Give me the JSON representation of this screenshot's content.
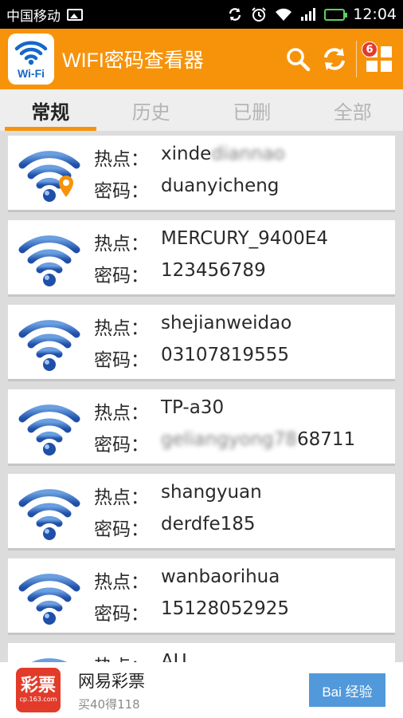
{
  "status_bar": {
    "carrier": "中国移动",
    "time": "12:04",
    "icons": [
      "image-icon",
      "sync-icon",
      "alarm-icon",
      "wifi-signal-icon",
      "cell-signal-icon",
      "battery-icon"
    ]
  },
  "header": {
    "logo_text": "Wi-Fi",
    "title": "WIFI密码查看器",
    "badge_count": "6",
    "icons": [
      "search-icon",
      "refresh-icon",
      "grid-menu-icon"
    ],
    "accent_color": "#f7930a"
  },
  "tabs": [
    {
      "label": "常规",
      "active": true
    },
    {
      "label": "历史",
      "active": false
    },
    {
      "label": "已删",
      "active": false
    },
    {
      "label": "全部",
      "active": false
    }
  ],
  "list": {
    "hotspot_label": "热点：",
    "password_label": "密码：",
    "items": [
      {
        "ssid": "xinde",
        "ssid_blurred": "diannao",
        "password": "duanyicheng",
        "password_blurred": "",
        "password_tail": "",
        "location_pin": true
      },
      {
        "ssid": "MERCURY_9400E4",
        "ssid_blurred": "",
        "password": "123456789",
        "password_blurred": "",
        "password_tail": "",
        "location_pin": false
      },
      {
        "ssid": "shejianweidao",
        "ssid_blurred": "",
        "password": "03107819555",
        "password_blurred": "",
        "password_tail": "",
        "location_pin": false
      },
      {
        "ssid": "TP-a30",
        "ssid_blurred": "",
        "password": "",
        "password_blurred": "geliangyong78",
        "password_tail": "68711",
        "location_pin": false
      },
      {
        "ssid": "shangyuan",
        "ssid_blurred": "",
        "password": "derdfe185",
        "password_blurred": "",
        "password_tail": "",
        "location_pin": false
      },
      {
        "ssid": "wanbaorihua",
        "ssid_blurred": "",
        "password": "15128052925",
        "password_blurred": "",
        "password_tail": "",
        "location_pin": false
      },
      {
        "ssid": "AU",
        "ssid_blurred": "",
        "password": "",
        "password_blurred": "",
        "password_tail": "",
        "location_pin": false
      }
    ]
  },
  "ad": {
    "logo_big": "彩票",
    "logo_small": "cp.163.com",
    "title": "网易彩票",
    "subtitle": "买40得118",
    "watermark": "Bai 经验"
  }
}
